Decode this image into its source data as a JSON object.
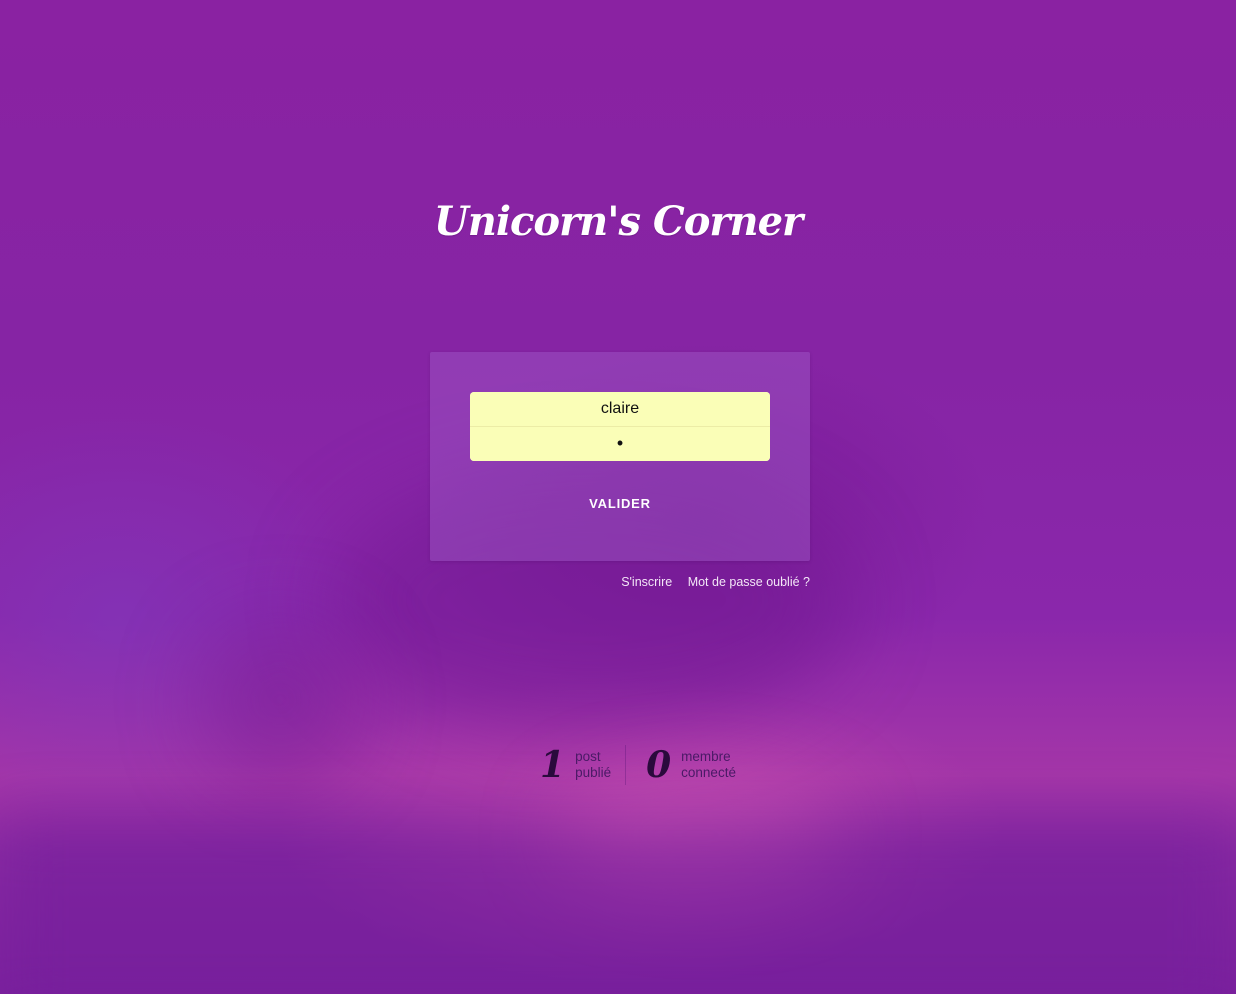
{
  "app": {
    "title": "Unicorn's Corner"
  },
  "login": {
    "username_value": "claire",
    "password_value": "•",
    "submit_label": "VALIDER"
  },
  "links": {
    "signup": "S'inscrire",
    "forgot_password": "Mot de passe oublié ?"
  },
  "stats": [
    {
      "value": "1",
      "label_line1": "post",
      "label_line2": "publié"
    },
    {
      "value": "0",
      "label_line1": "membre",
      "label_line2": "connecté"
    }
  ],
  "colors": {
    "background": "#8a24a6",
    "input_background": "#fafeb7",
    "text_light": "#ffffff",
    "stat_number": "#2a0a3c"
  }
}
